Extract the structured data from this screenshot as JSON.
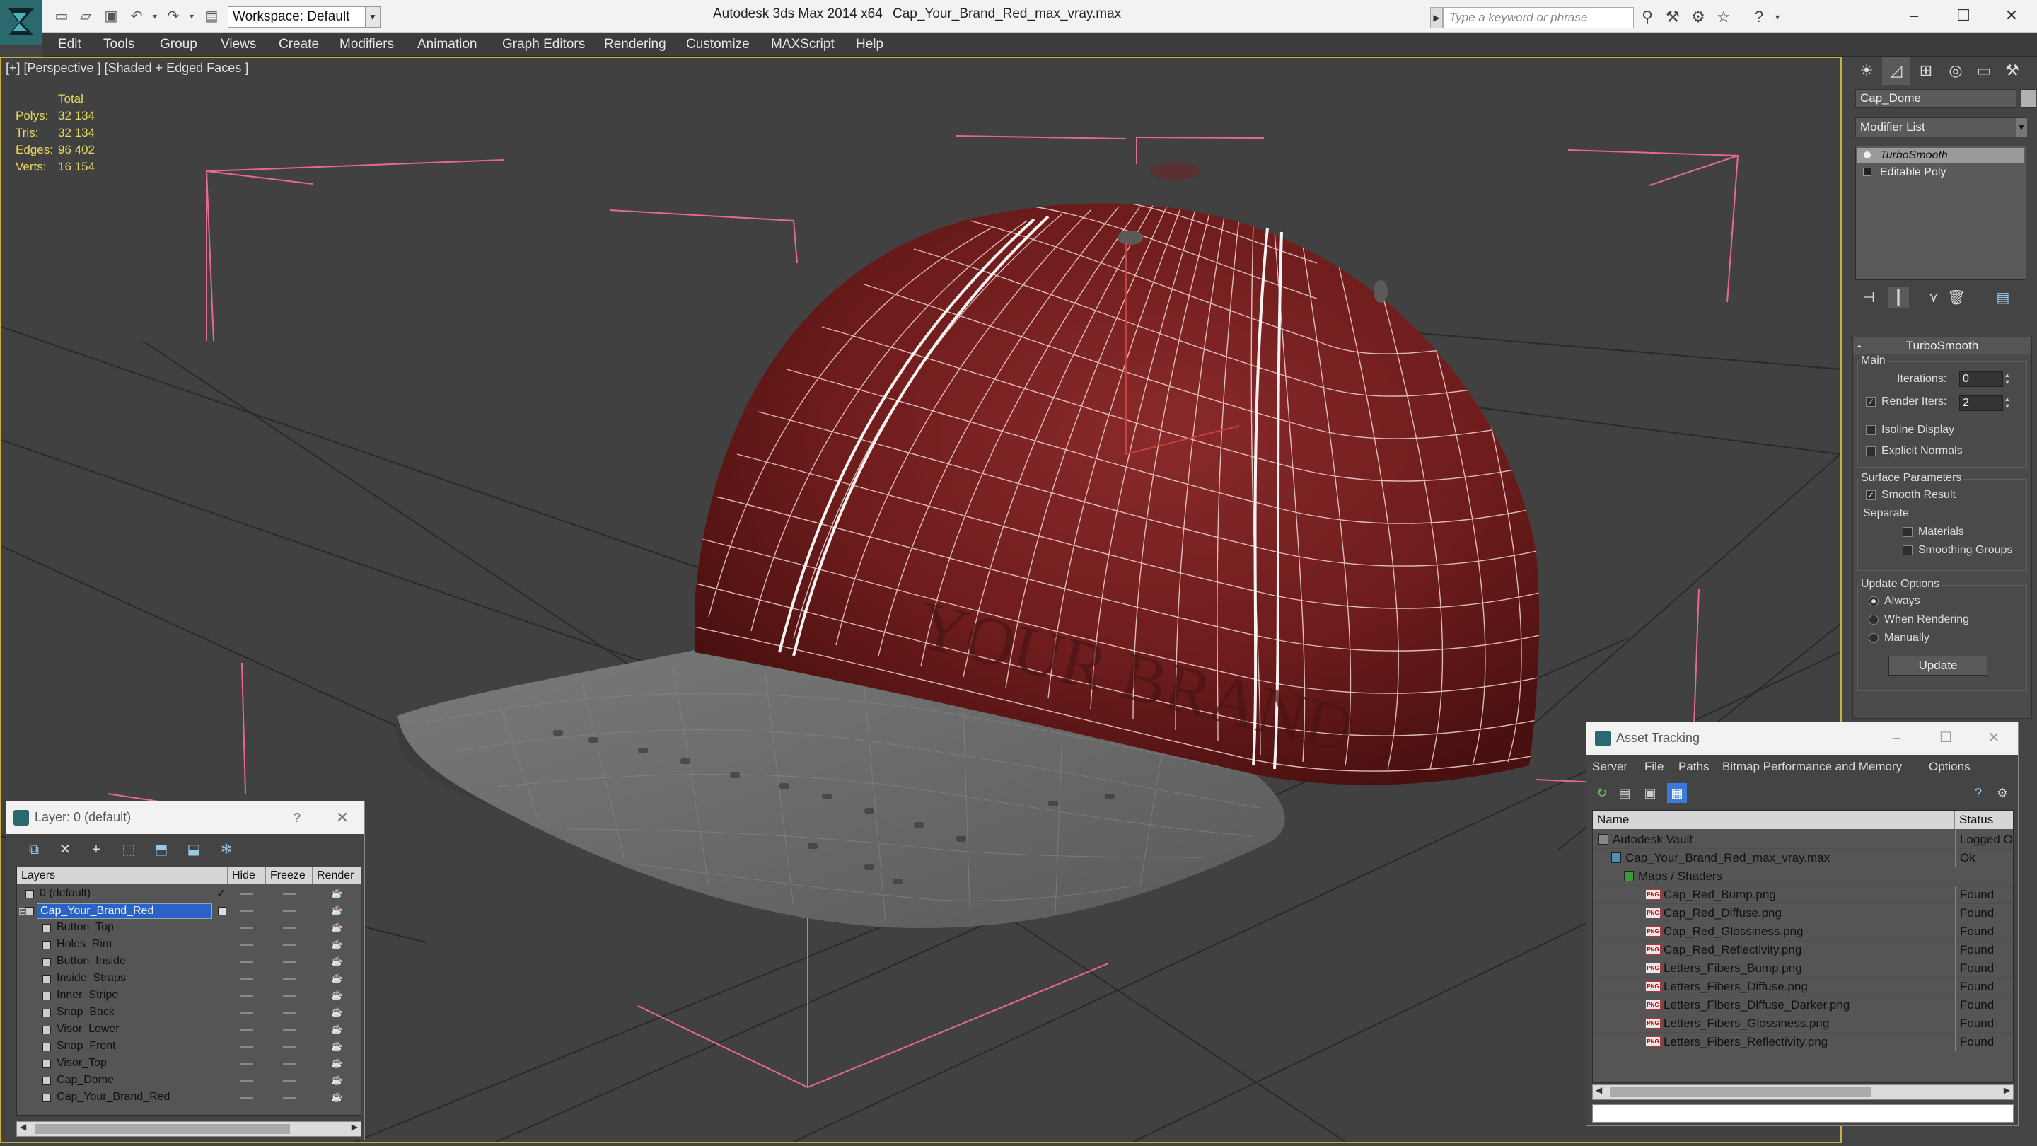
{
  "titlebar": {
    "workspace": "Workspace: Default",
    "app_title": "Autodesk 3ds Max  2014 x64",
    "file_title": "Cap_Your_Brand_Red_max_vray.max",
    "search_placeholder": "Type a keyword or phrase"
  },
  "menu": [
    "Edit",
    "Tools",
    "Group",
    "Views",
    "Create",
    "Modifiers",
    "Animation",
    "Graph Editors",
    "Rendering",
    "Customize",
    "MAXScript",
    "Help"
  ],
  "viewport": {
    "label": "[+] [Perspective ] [Shaded + Edged Faces ]",
    "stats": {
      "header": "Total",
      "rows": [
        {
          "label": "Polys:",
          "value": "32 134"
        },
        {
          "label": "Tris:",
          "value": "32 134"
        },
        {
          "label": "Edges:",
          "value": "96 402"
        },
        {
          "label": "Verts:",
          "value": "16 154"
        }
      ]
    },
    "model_text": "YOUR BRAND"
  },
  "command_panel": {
    "object_name": "Cap_Dome",
    "modifier_list": "Modifier List",
    "stack": [
      "TurboSmooth",
      "Editable Poly"
    ],
    "turbosmooth": {
      "title": "TurboSmooth",
      "main_group": "Main",
      "iterations_label": "Iterations:",
      "iterations_value": "0",
      "render_iters_label": "Render Iters:",
      "render_iters_value": "2",
      "render_iters_checked": true,
      "isoline_display": "Isoline Display",
      "explicit_normals": "Explicit Normals",
      "surface_group": "Surface Parameters",
      "smooth_result": "Smooth Result",
      "separate": "Separate",
      "materials": "Materials",
      "smoothing_groups": "Smoothing Groups",
      "update_group": "Update Options",
      "always": "Always",
      "when_rendering": "When Rendering",
      "manually": "Manually",
      "update_button": "Update"
    }
  },
  "layer_dialog": {
    "title": "Layer: 0 (default)",
    "columns": [
      "Layers",
      "Hide",
      "Freeze",
      "Render"
    ],
    "rows": [
      {
        "name": "0 (default)",
        "level": 0
      },
      {
        "name": "Cap_Your_Brand_Red",
        "level": 0
      },
      {
        "name": "Button_Top",
        "level": 1
      },
      {
        "name": "Holes_Rim",
        "level": 1
      },
      {
        "name": "Button_Inside",
        "level": 1
      },
      {
        "name": "Inside_Straps",
        "level": 1
      },
      {
        "name": "Inner_Stripe",
        "level": 1
      },
      {
        "name": "Snap_Back",
        "level": 1
      },
      {
        "name": "Visor_Lower",
        "level": 1
      },
      {
        "name": "Snap_Front",
        "level": 1
      },
      {
        "name": "Visor_Top",
        "level": 1
      },
      {
        "name": "Cap_Dome",
        "level": 1
      },
      {
        "name": "Cap_Your_Brand_Red",
        "level": 1
      }
    ]
  },
  "asset_dialog": {
    "title": "Asset Tracking",
    "menu": [
      "Server",
      "File",
      "Paths",
      "Bitmap Performance and Memory",
      "Options"
    ],
    "columns": [
      "Name",
      "Status"
    ],
    "rows": [
      {
        "name": "Autodesk Vault",
        "status": "Logged Out",
        "level": 0
      },
      {
        "name": "Cap_Your_Brand_Red_max_vray.max",
        "status": "Ok",
        "level": 1
      },
      {
        "name": "Maps / Shaders",
        "status": "",
        "level": 2
      },
      {
        "name": "Cap_Red_Bump.png",
        "status": "Found",
        "level": 3
      },
      {
        "name": "Cap_Red_Diffuse.png",
        "status": "Found",
        "level": 3
      },
      {
        "name": "Cap_Red_Glossiness.png",
        "status": "Found",
        "level": 3
      },
      {
        "name": "Cap_Red_Reflectivity.png",
        "status": "Found",
        "level": 3
      },
      {
        "name": "Letters_Fibers_Bump.png",
        "status": "Found",
        "level": 3
      },
      {
        "name": "Letters_Fibers_Diffuse.png",
        "status": "Found",
        "level": 3
      },
      {
        "name": "Letters_Fibers_Diffuse_Darker.png",
        "status": "Found",
        "level": 3
      },
      {
        "name": "Letters_Fibers_Glossiness.png",
        "status": "Found",
        "level": 3
      },
      {
        "name": "Letters_Fibers_Reflectivity.png",
        "status": "Found",
        "level": 3
      }
    ]
  },
  "colors": {
    "viewport_bg": "#414141",
    "cap_red": "#7a1e1e",
    "visor_gray": "#6e6e6e",
    "bbox_pink": "#e86a8a",
    "stats_yellow": "#e8d860",
    "selection_blue": "#2a62c8"
  }
}
